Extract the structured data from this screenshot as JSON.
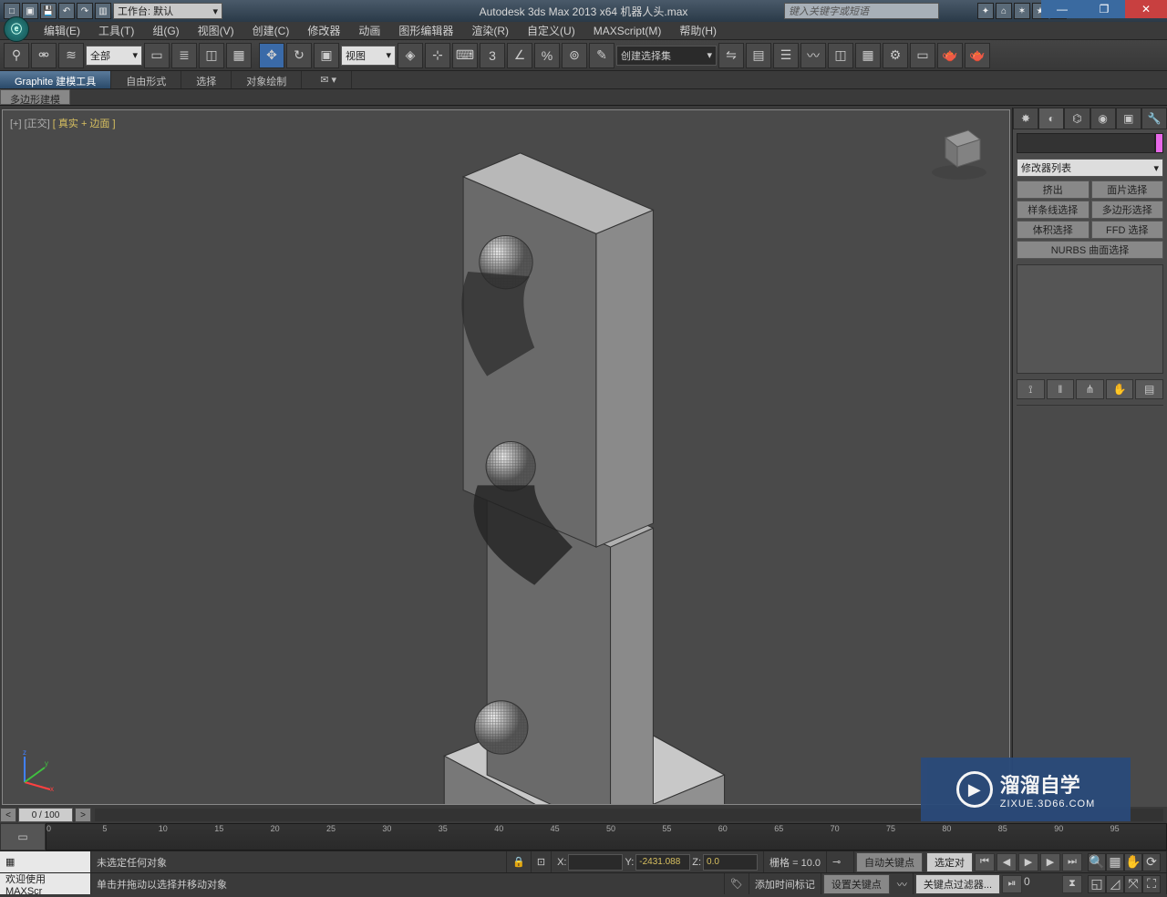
{
  "titlebar": {
    "workspace_label": "工作台: 默认",
    "app_title": "Autodesk 3ds Max  2013 x64    机器人头.max",
    "search_placeholder": "键入关键字或短语"
  },
  "menus": {
    "edit": "编辑(E)",
    "tools": "工具(T)",
    "group": "组(G)",
    "views": "视图(V)",
    "create": "创建(C)",
    "modifiers": "修改器",
    "animation": "动画",
    "graph": "图形编辑器",
    "rendering": "渲染(R)",
    "customize": "自定义(U)",
    "maxscript": "MAXScript(M)",
    "help": "帮助(H)"
  },
  "maintoolbar": {
    "filter_all": "全部",
    "view_ref": "视图",
    "named_sel": "创建选择集"
  },
  "ribbon": {
    "tab1": "Graphite 建模工具",
    "tab2": "自由形式",
    "tab3": "选择",
    "tab4": "对象绘制",
    "panel1": "多边形建模"
  },
  "viewport": {
    "label_prefix": "[+] [正交]",
    "label_shaded": "[ 真实 + 边面 ]"
  },
  "cmdpanel": {
    "modlist": "修改器列表",
    "btn_extrude": "挤出",
    "btn_faceSel": "面片选择",
    "btn_splineSel": "样条线选择",
    "btn_polySel": "多边形选择",
    "btn_volSel": "体积选择",
    "btn_ffdSel": "FFD 选择",
    "btn_nurbsSel": "NURBS 曲面选择"
  },
  "timeslider": {
    "frame_label": "0 / 100",
    "ticks": [
      "0",
      "5",
      "10",
      "15",
      "20",
      "25",
      "30",
      "35",
      "40",
      "45",
      "50",
      "55",
      "60",
      "65",
      "70",
      "75",
      "80",
      "85",
      "90",
      "95"
    ]
  },
  "status": {
    "welcome": "欢迎使用  MAXScr",
    "no_sel": "未选定任何对象",
    "prompt": "单击并拖动以选择并移动对象",
    "x_label": "X:",
    "x_val": "",
    "y_label": "Y:",
    "y_val": "-2431.088",
    "z_label": "Z:",
    "z_val": "0.0",
    "grid": "栅格 = 10.0",
    "add_time_tag": "添加时间标记",
    "auto_key": "自动关键点",
    "set_key": "设置关键点",
    "sel_locked": "选定对",
    "key_filters": "关键点过滤器...",
    "cur_frame": "0"
  },
  "watermark": {
    "title": "溜溜自学",
    "url": "ZIXUE.3D66.COM"
  }
}
